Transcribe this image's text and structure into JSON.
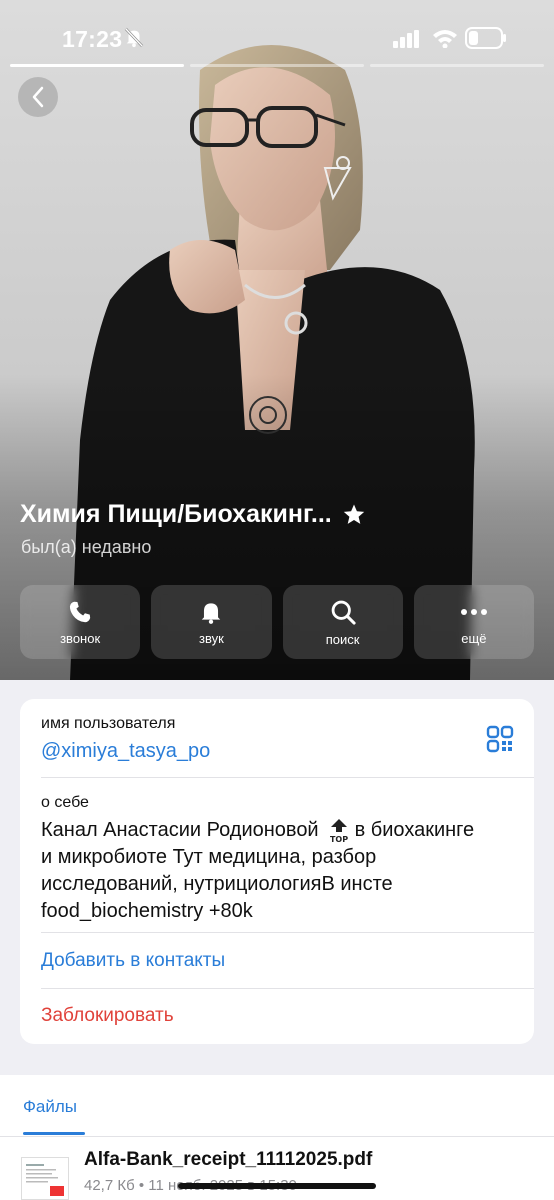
{
  "status_bar": {
    "time": "17:23"
  },
  "profile": {
    "name": "Химия Пищи/Биохакинг...",
    "last_seen": "был(а) недавно"
  },
  "actions": [
    {
      "label": "звонок",
      "icon": "phone-icon"
    },
    {
      "label": "звук",
      "icon": "bell-icon"
    },
    {
      "label": "поиск",
      "icon": "search-icon"
    },
    {
      "label": "ещё",
      "icon": "more-icon"
    }
  ],
  "info": {
    "username_label": "имя пользователя",
    "username": "@ximiya_tasya_po",
    "about_label": "о себе",
    "about_part1": "Канал Анастасии Родионовой",
    "about_badge": "TOP",
    "about_part2": "в биохакинге и микробиоте Тут медицина, разбор исследований, нутрициологияВ инсте food_biochemistry +80k",
    "add_contact": "Добавить в контакты",
    "block": "Заблокировать"
  },
  "files": {
    "tab_label": "Файлы",
    "items": [
      {
        "name": "Alfa-Bank_receipt_11112025.pdf",
        "meta": "42,7 Кб • 11 нояб. 2025 в 15:30"
      }
    ]
  },
  "colors": {
    "accent": "#2a7dd8",
    "danger": "#e0423a",
    "background": "#efeff4"
  }
}
